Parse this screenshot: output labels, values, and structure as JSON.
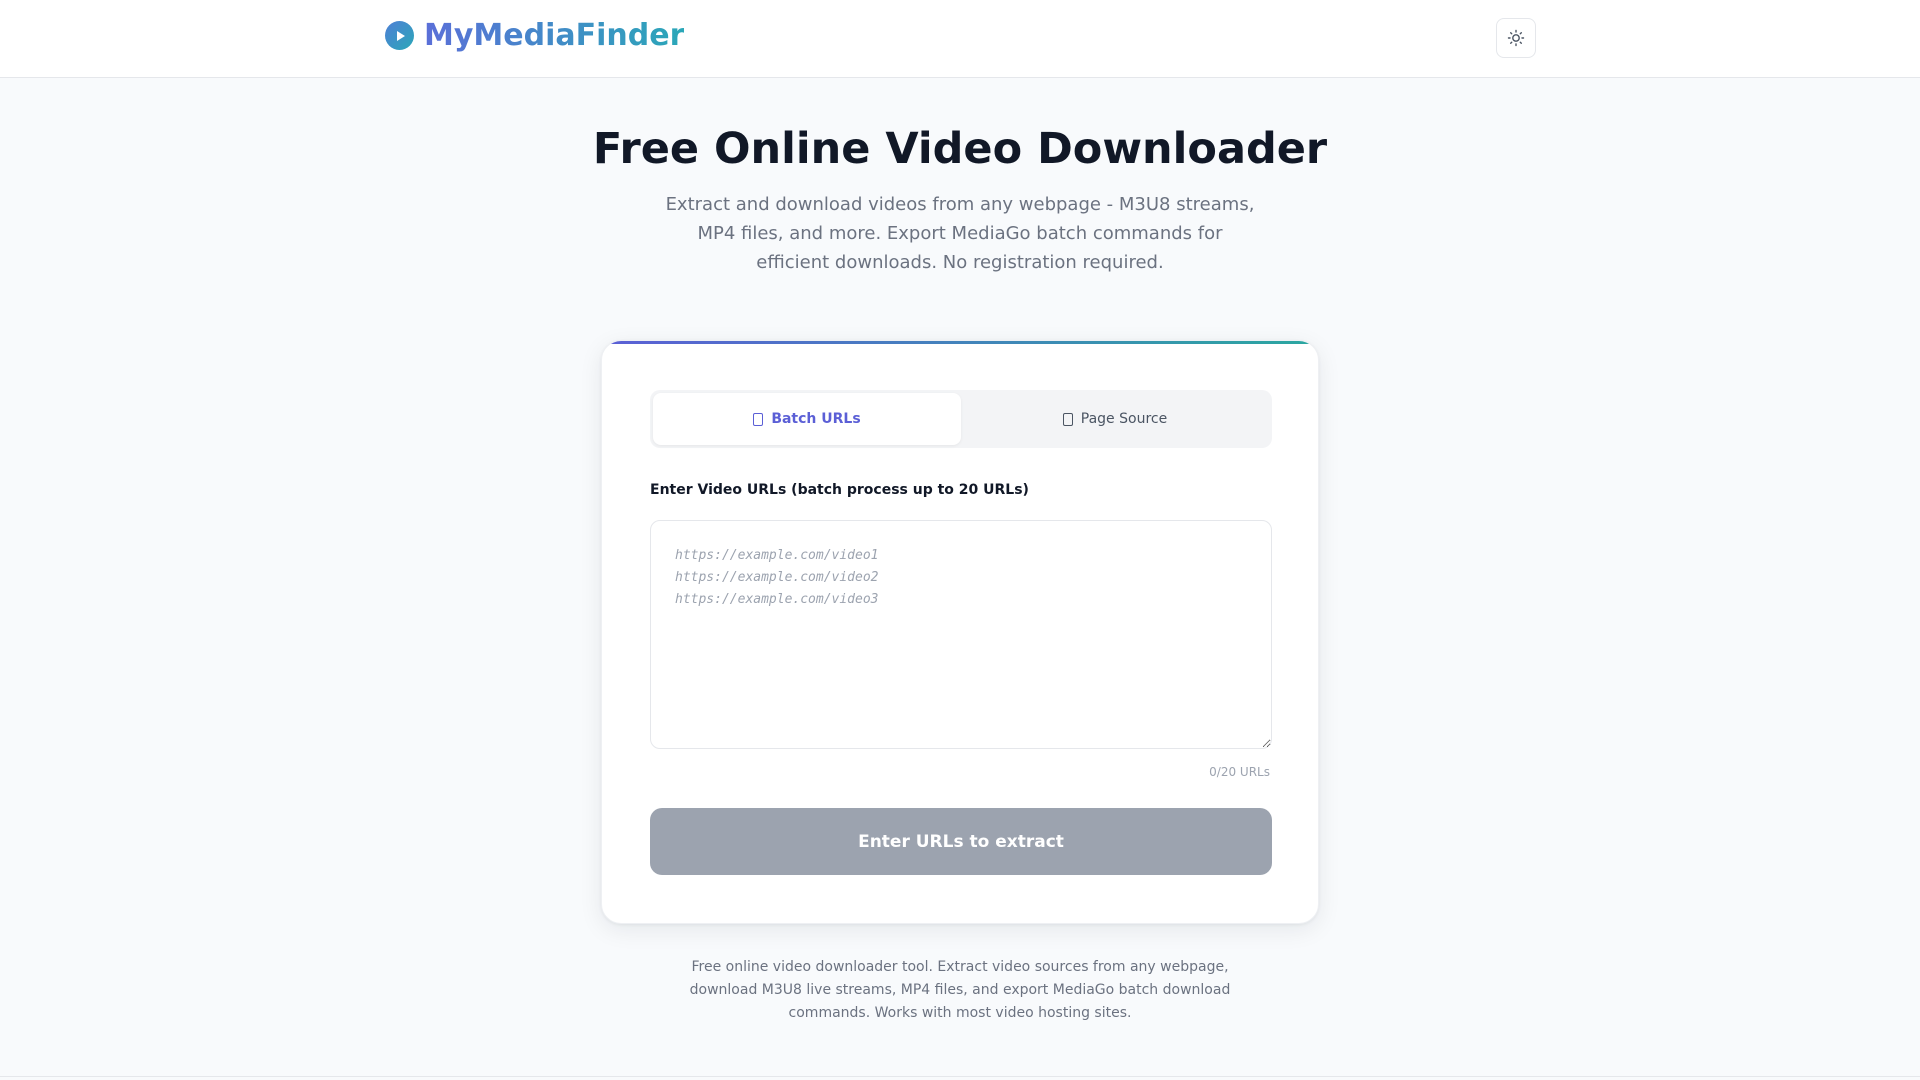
{
  "header": {
    "brand": "MyMediaFinder",
    "logo_icon": "play-circle-icon",
    "theme_icon": "sun-icon"
  },
  "hero": {
    "title": "Free Online Video Downloader",
    "subtitle": "Extract and download videos from any webpage - M3U8 streams, MP4 files, and more. Export MediaGo batch commands for efficient downloads. No registration required."
  },
  "card": {
    "tabs": [
      {
        "label": "Batch URLs",
        "icon": "document-icon",
        "active": true
      },
      {
        "label": "Page Source",
        "icon": "document-icon",
        "active": false
      }
    ],
    "field_label": "Enter Video URLs (batch process up to 20 URLs)",
    "input_value": "",
    "input_placeholder": "https://example.com/video1\nhttps://example.com/video2\nhttps://example.com/video3",
    "url_count": "0/20 URLs",
    "button_label": "Enter URLs to extract"
  },
  "footer": {
    "description": "Free online video downloader tool. Extract video sources from any webpage, download M3U8 live streams, MP4 files, and export MediaGo batch download commands. Works with most video hosting sites."
  },
  "colors": {
    "accent": "#5b5fd6",
    "teal": "#2aa7a0",
    "button_disabled": "#9ca3af",
    "background": "#f8fafc"
  }
}
